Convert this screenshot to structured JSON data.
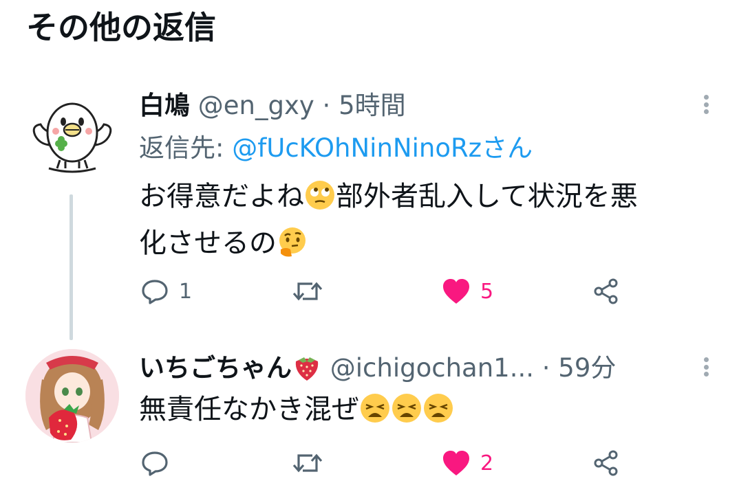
{
  "section": {
    "title": "その他の返信"
  },
  "tweets": [
    {
      "name": "白鳩",
      "handle": "@en_gxy",
      "dot": "·",
      "time": "5時間",
      "reply_prefix": "返信先: ",
      "reply_mention": "@fUcKOhNinNinoRzさん",
      "text_line1": "お得意だよね",
      "text_line1b": "部外者乱入して状況を悪",
      "text_line2": "化させるの",
      "emoji1": "face-with-rolling-eyes",
      "emoji2": "thinking-face",
      "reply_count": "1",
      "retweet_count": "",
      "like_count": "5",
      "liked": true
    },
    {
      "name": "いちごちゃん",
      "name_emoji": "strawberry",
      "handle": "@ichigochan1...",
      "dot": "·",
      "time": "59分",
      "text": "無責任なかき混ぜ",
      "text_emoji": "weary-face",
      "reply_count": "",
      "retweet_count": "",
      "like_count": "2",
      "liked": true
    }
  ],
  "colors": {
    "accent": "#1d9bf0",
    "like": "#f91880",
    "muted": "#536471",
    "text": "#0f1419"
  }
}
